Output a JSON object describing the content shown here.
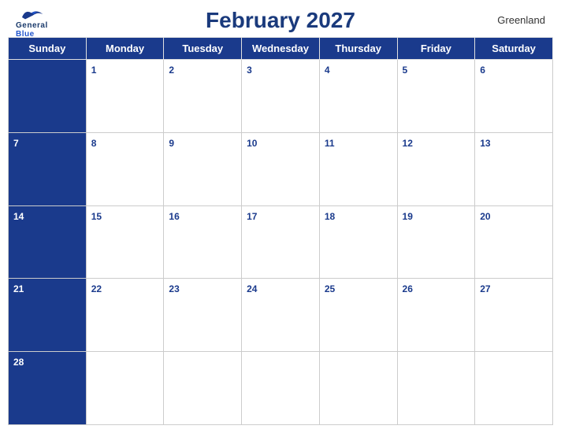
{
  "header": {
    "title": "February 2027",
    "region": "Greenland",
    "logo_line1": "General",
    "logo_line2": "Blue"
  },
  "days": [
    "Sunday",
    "Monday",
    "Tuesday",
    "Wednesday",
    "Thursday",
    "Friday",
    "Saturday"
  ],
  "weeks": [
    [
      {
        "date": "",
        "blue": true
      },
      {
        "date": "1",
        "blue": false
      },
      {
        "date": "2",
        "blue": false
      },
      {
        "date": "3",
        "blue": false
      },
      {
        "date": "4",
        "blue": false
      },
      {
        "date": "5",
        "blue": false
      },
      {
        "date": "6",
        "blue": false
      }
    ],
    [
      {
        "date": "7",
        "blue": true
      },
      {
        "date": "8",
        "blue": false
      },
      {
        "date": "9",
        "blue": false
      },
      {
        "date": "10",
        "blue": false
      },
      {
        "date": "11",
        "blue": false
      },
      {
        "date": "12",
        "blue": false
      },
      {
        "date": "13",
        "blue": false
      }
    ],
    [
      {
        "date": "14",
        "blue": true
      },
      {
        "date": "15",
        "blue": false
      },
      {
        "date": "16",
        "blue": false
      },
      {
        "date": "17",
        "blue": false
      },
      {
        "date": "18",
        "blue": false
      },
      {
        "date": "19",
        "blue": false
      },
      {
        "date": "20",
        "blue": false
      }
    ],
    [
      {
        "date": "21",
        "blue": true
      },
      {
        "date": "22",
        "blue": false
      },
      {
        "date": "23",
        "blue": false
      },
      {
        "date": "24",
        "blue": false
      },
      {
        "date": "25",
        "blue": false
      },
      {
        "date": "26",
        "blue": false
      },
      {
        "date": "27",
        "blue": false
      }
    ],
    [
      {
        "date": "28",
        "blue": true
      },
      {
        "date": "",
        "blue": false
      },
      {
        "date": "",
        "blue": false
      },
      {
        "date": "",
        "blue": false
      },
      {
        "date": "",
        "blue": false
      },
      {
        "date": "",
        "blue": false
      },
      {
        "date": "",
        "blue": false
      }
    ]
  ]
}
